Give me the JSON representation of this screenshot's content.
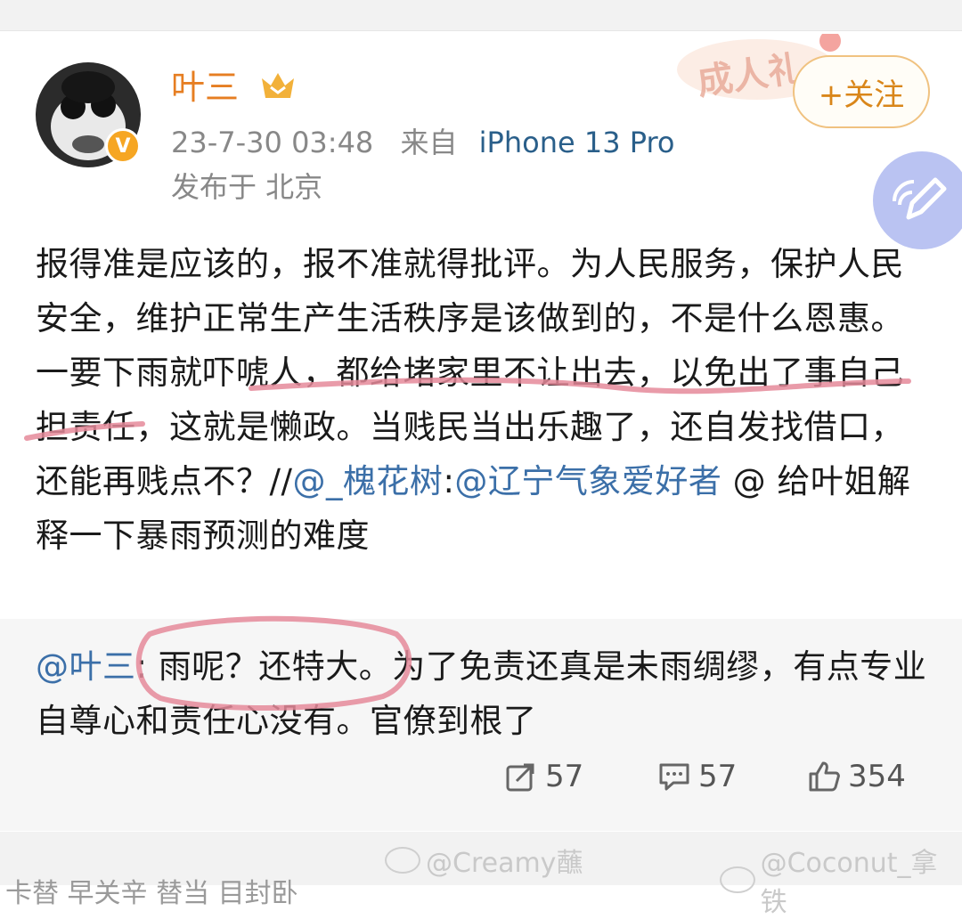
{
  "header": {
    "username": "叶三",
    "timestamp": "23-7-30 03:48",
    "source_prefix": "来自",
    "source_device": "iPhone 13 Pro",
    "location": "发布于 北京",
    "verified_badge": "V",
    "follow_label": "+关注",
    "sticker_text": "成人礼"
  },
  "post": {
    "text_part1": "报得准是应该的，报不准就得批评。为人民服务，保护人民安全，维护正常生产生活秩序是该做到的，不是什么恩惠。一要下雨就吓唬人，都给堵家里不让出去，以免出了事自己担责任，这就是懒政。当贱民当出乐趣了，还自发找借口，还能再贱点不？//",
    "mention1": "@_槐花树",
    "colon": ":",
    "mention2": "@辽宁气象爱好者",
    "text_part2": " @ 给叶姐解释一下暴雨预测的难度"
  },
  "quote": {
    "mention": "@叶三",
    "colon": ":",
    "text": " 雨呢？还特大。为了免责还真是未雨绸缪，有点专业自尊心和责任心没有。官僚到根了"
  },
  "actions": {
    "repost_count": "57",
    "comment_count": "57",
    "like_count": "354"
  },
  "watermarks": {
    "wm1": "@Creamy蘸",
    "wm2": "@Coconut_拿铁"
  },
  "bottom_cut_text": "卡替 早关辛 替当 目封卧",
  "colors": {
    "username": "#e67e22",
    "link": "#3b6fa8",
    "underline_marker": "#e58a9a",
    "follow_border": "#f0c280"
  }
}
